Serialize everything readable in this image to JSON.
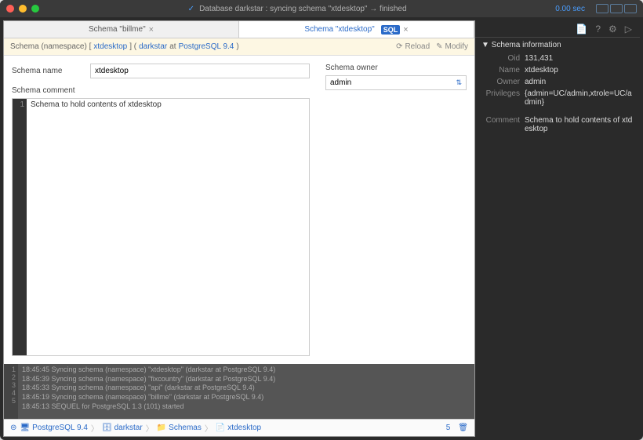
{
  "titlebar": {
    "status": "Database darkstar : syncing schema \"xtdesktop\" → finished",
    "time": "0.00 sec"
  },
  "tabs": [
    {
      "label": "Schema \"billme\"",
      "active": false
    },
    {
      "label": "Schema \"xtdesktop\"",
      "active": true,
      "sql": "SQL"
    }
  ],
  "breadcrumb": {
    "prefix": "Schema (namespace) [",
    "link1": "xtdesktop",
    "mid1": "] (",
    "link2": "darkstar",
    "mid2": " at ",
    "link3": "PostgreSQL 9.4",
    "suffix": ")",
    "reload": "Reload",
    "modify": "Modify"
  },
  "form": {
    "name_label": "Schema name",
    "name_value": "xtdesktop",
    "owner_label": "Schema owner",
    "owner_value": "admin",
    "comment_label": "Schema comment",
    "comment_value": "Schema to hold contents of xtdesktop"
  },
  "log": [
    "18:45:45 Syncing schema (namespace) \"xtdesktop\" (darkstar at PostgreSQL 9.4)",
    "18:45:39 Syncing schema (namespace) \"fixcountry\" (darkstar at PostgreSQL 9.4)",
    "18:45:33 Syncing schema (namespace) \"api\" (darkstar at PostgreSQL 9.4)",
    "18:45:19 Syncing schema (namespace) \"billme\" (darkstar at PostgreSQL 9.4)",
    "18:45:13 SEQUEL for PostgreSQL 1.3 (101) started"
  ],
  "footer": {
    "c1": "PostgreSQL 9.4",
    "c2": "darkstar",
    "c3": "Schemas",
    "c4": "xtdesktop",
    "count": "5"
  },
  "side": {
    "title": "▼ Schema information",
    "rows": {
      "oid_k": "Oid",
      "oid_v": "131,431",
      "name_k": "Name",
      "name_v": "xtdesktop",
      "owner_k": "Owner",
      "owner_v": "admin",
      "priv_k": "Privileges",
      "priv_v": "{admin=UC/admin,xtrole=UC/admin}",
      "comm_k": "Comment",
      "comm_v": "Schema to hold contents of xtdesktop"
    }
  }
}
